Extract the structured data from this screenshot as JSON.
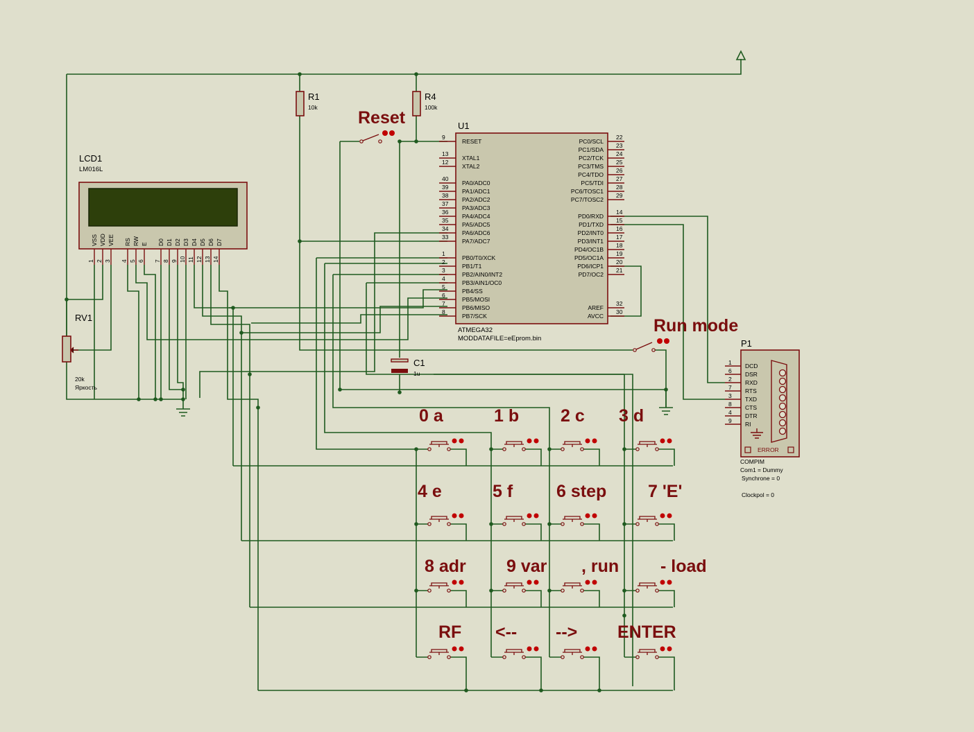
{
  "lcd": {
    "ref": "LCD1",
    "model": "LM016L",
    "pins": [
      {
        "label": "VSS",
        "num": "1"
      },
      {
        "label": "VDD",
        "num": "2"
      },
      {
        "label": "VEE",
        "num": "3"
      },
      {
        "label": "RS",
        "num": "4"
      },
      {
        "label": "RW",
        "num": "5"
      },
      {
        "label": "E",
        "num": "6"
      },
      {
        "label": "D0",
        "num": "7"
      },
      {
        "label": "D1",
        "num": "8"
      },
      {
        "label": "D2",
        "num": "9"
      },
      {
        "label": "D3",
        "num": "10"
      },
      {
        "label": "D4",
        "num": "11"
      },
      {
        "label": "D5",
        "num": "12"
      },
      {
        "label": "D6",
        "num": "13"
      },
      {
        "label": "D7",
        "num": "14"
      }
    ]
  },
  "rv1": {
    "ref": "RV1",
    "value": "20k",
    "caption": "Яркость"
  },
  "r1": {
    "ref": "R1",
    "value": "10k"
  },
  "r4": {
    "ref": "R4",
    "value": "100k"
  },
  "c1": {
    "ref": "C1",
    "value": "1u"
  },
  "reset_label": "Reset",
  "runmode_label": "Run mode",
  "mcu": {
    "ref": "U1",
    "part": "ATMEGA32",
    "datafile": "MODDATAFILE=eEprom.bin",
    "left": [
      {
        "num": "9",
        "label": "RESET"
      },
      {
        "num": "13",
        "label": "XTAL1"
      },
      {
        "num": "12",
        "label": "XTAL2"
      },
      {
        "num": "40",
        "label": "PA0/ADC0"
      },
      {
        "num": "39",
        "label": "PA1/ADC1"
      },
      {
        "num": "38",
        "label": "PA2/ADC2"
      },
      {
        "num": "37",
        "label": "PA3/ADC3"
      },
      {
        "num": "36",
        "label": "PA4/ADC4"
      },
      {
        "num": "35",
        "label": "PA5/ADC5"
      },
      {
        "num": "34",
        "label": "PA6/ADC6"
      },
      {
        "num": "33",
        "label": "PA7/ADC7"
      },
      {
        "num": "1",
        "label": "PB0/T0/XCK"
      },
      {
        "num": "2",
        "label": "PB1/T1"
      },
      {
        "num": "3",
        "label": "PB2/AIN0/INT2"
      },
      {
        "num": "4",
        "label": "PB3/AIN1/OC0"
      },
      {
        "num": "5",
        "label": "PB4/SS"
      },
      {
        "num": "6",
        "label": "PB5/MOSI"
      },
      {
        "num": "7",
        "label": "PB6/MISO"
      },
      {
        "num": "8",
        "label": "PB7/SCK"
      }
    ],
    "right": [
      {
        "num": "22",
        "label": "PC0/SCL"
      },
      {
        "num": "23",
        "label": "PC1/SDA"
      },
      {
        "num": "24",
        "label": "PC2/TCK"
      },
      {
        "num": "25",
        "label": "PC3/TMS"
      },
      {
        "num": "26",
        "label": "PC4/TDO"
      },
      {
        "num": "27",
        "label": "PC5/TDI"
      },
      {
        "num": "28",
        "label": "PC6/TOSC1"
      },
      {
        "num": "29",
        "label": "PC7/TOSC2"
      },
      {
        "num": "14",
        "label": "PD0/RXD"
      },
      {
        "num": "15",
        "label": "PD1/TXD"
      },
      {
        "num": "16",
        "label": "PD2/INT0"
      },
      {
        "num": "17",
        "label": "PD3/INT1"
      },
      {
        "num": "18",
        "label": "PD4/OC1B"
      },
      {
        "num": "19",
        "label": "PD5/OC1A"
      },
      {
        "num": "20",
        "label": "PD6/ICP1"
      },
      {
        "num": "21",
        "label": "PD7/OC2"
      },
      {
        "num": "32",
        "label": "AREF"
      },
      {
        "num": "30",
        "label": "AVCC"
      }
    ]
  },
  "p1": {
    "ref": "P1",
    "pins": [
      {
        "num": "1",
        "label": "DCD"
      },
      {
        "num": "6",
        "label": "DSR"
      },
      {
        "num": "2",
        "label": "RXD"
      },
      {
        "num": "7",
        "label": "RTS"
      },
      {
        "num": "3",
        "label": "TXD"
      },
      {
        "num": "8",
        "label": "CTS"
      },
      {
        "num": "4",
        "label": "DTR"
      },
      {
        "num": "9",
        "label": "RI"
      }
    ],
    "error": "ERROR",
    "props": [
      "COMPIM",
      "Com1 = Dummy",
      "Synchrone = 0",
      "Clockpol = 0"
    ]
  },
  "keys": [
    [
      "0 a",
      "1 b",
      "2 c",
      "3 d"
    ],
    [
      "4 e",
      "5  f",
      "6 step",
      "7 'E'"
    ],
    [
      "8  adr",
      "9  var",
      ",  run",
      "- load"
    ],
    [
      "RF",
      "<--",
      "-->",
      "ENTER"
    ]
  ]
}
